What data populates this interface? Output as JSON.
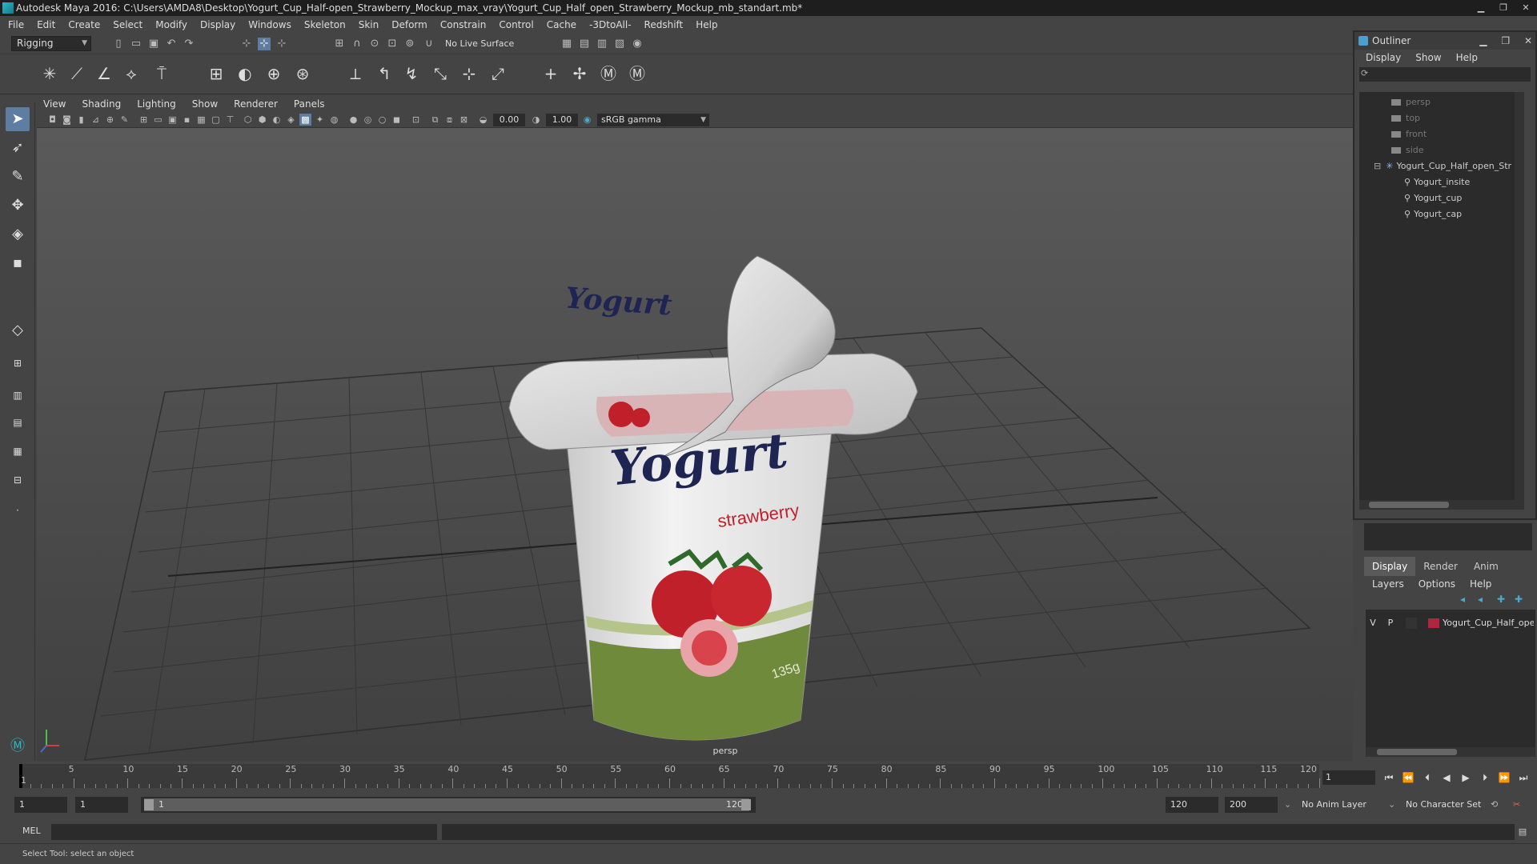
{
  "window": {
    "title": "Autodesk Maya 2016: C:\\Users\\AMDA8\\Desktop\\Yogurt_Cup_Half-open_Strawberry_Mockup_max_vray\\Yogurt_Cup_Half_open_Strawberry_Mockup_mb_standart.mb*"
  },
  "menubar": [
    "File",
    "Edit",
    "Create",
    "Select",
    "Modify",
    "Display",
    "Windows",
    "Skeleton",
    "Skin",
    "Deform",
    "Constrain",
    "Control",
    "Cache",
    "-3DtoAll-",
    "Redshift",
    "Help"
  ],
  "status_toolbar": {
    "mode": "Rigging",
    "live_surface": "No Live Surface"
  },
  "panel": {
    "menu": [
      "View",
      "Shading",
      "Lighting",
      "Show",
      "Renderer",
      "Panels"
    ],
    "exposure": "0.00",
    "gamma": "1.00",
    "color_space": "sRGB gamma",
    "camera": "persp"
  },
  "product": {
    "brand": "Yogurt",
    "flavor": "strawberry",
    "weight": "135g"
  },
  "outliner": {
    "title": "Outliner",
    "menu": [
      "Display",
      "Show",
      "Help"
    ],
    "cameras": [
      "persp",
      "top",
      "front",
      "side"
    ],
    "group": "Yogurt_Cup_Half_open_Str",
    "children": [
      "Yogurt_insite",
      "Yogurt_cup",
      "Yogurt_cap"
    ]
  },
  "layers": {
    "tabs": [
      "Display",
      "Render",
      "Anim"
    ],
    "menu": [
      "Layers",
      "Options",
      "Help"
    ],
    "row": {
      "v": "V",
      "p": "P",
      "name": "Yogurt_Cup_Half_oper",
      "color": "#b0253f"
    }
  },
  "timeline": {
    "ticks": [
      "5",
      "10",
      "15",
      "20",
      "25",
      "30",
      "35",
      "40",
      "45",
      "50",
      "55",
      "60",
      "65",
      "70",
      "75",
      "80",
      "85",
      "90",
      "95",
      "100",
      "105",
      "110",
      "115",
      "120"
    ],
    "first_label": "1",
    "current_frame": "1"
  },
  "range": {
    "start": "1",
    "playback_start": "1",
    "slider_start": "1",
    "slider_end": "120",
    "playback_end": "120",
    "end": "200",
    "anim_layer": "No Anim Layer",
    "character_set": "No Character Set"
  },
  "command": {
    "label": "MEL"
  },
  "status": {
    "help_line": "Select Tool: select an object"
  }
}
